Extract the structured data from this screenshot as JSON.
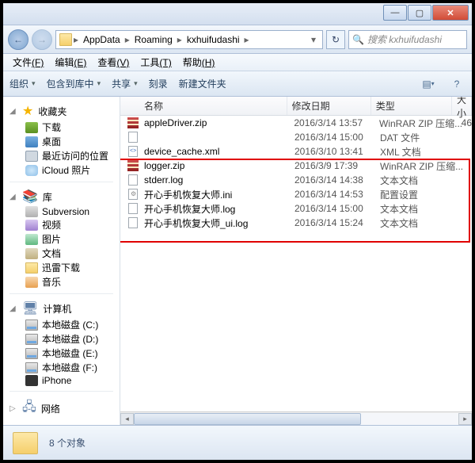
{
  "titlebar": {
    "min": "—",
    "max": "▢",
    "close": "✕"
  },
  "nav": {
    "back": "←",
    "forward": "→",
    "crumbs": [
      "AppData",
      "Roaming",
      "kxhuifudashi"
    ],
    "sep": "▸",
    "dropdown": "▾",
    "refresh": "↻"
  },
  "search": {
    "icon": "🔍",
    "placeholder": "搜索 kxhuifudashi"
  },
  "menu": {
    "file": {
      "label": "文件",
      "key": "(F)"
    },
    "edit": {
      "label": "编辑",
      "key": "(E)"
    },
    "view": {
      "label": "查看",
      "key": "(V)"
    },
    "tools": {
      "label": "工具",
      "key": "(T)"
    },
    "help": {
      "label": "帮助",
      "key": "(H)"
    }
  },
  "toolbar": {
    "organize": "组织",
    "include": "包含到库中",
    "share": "共享",
    "burn": "刻录",
    "newfolder": "新建文件夹",
    "arrow": "▾",
    "view_icon": "▤",
    "help_icon": "?"
  },
  "columns": {
    "name": "名称",
    "date": "修改日期",
    "type": "类型",
    "size": "大小"
  },
  "sidebar": {
    "fav": {
      "label": "收藏夹",
      "icon": "★"
    },
    "fav_items": [
      "下载",
      "桌面",
      "最近访问的位置",
      "iCloud 照片"
    ],
    "lib": {
      "label": "库",
      "icon": "📚"
    },
    "lib_items": [
      "Subversion",
      "视频",
      "图片",
      "文档",
      "迅雷下载",
      "音乐"
    ],
    "pc": {
      "label": "计算机",
      "icon": "🖥"
    },
    "pc_items": [
      "本地磁盘 (C:)",
      "本地磁盘 (D:)",
      "本地磁盘 (E:)",
      "本地磁盘 (F:)",
      "iPhone"
    ],
    "net": {
      "label": "网络",
      "icon": "🖧"
    },
    "expander_open": "◢",
    "expander_right": "▷"
  },
  "files": [
    {
      "icon": "zip",
      "name": "appleDriver.zip",
      "date": "2016/3/14 13:57",
      "type": "WinRAR ZIP 压缩...",
      "size": "46"
    },
    {
      "icon": "file",
      "name": "",
      "date": "2016/3/14 15:00",
      "type": "DAT 文件",
      "size": ""
    },
    {
      "icon": "xml",
      "name": "device_cache.xml",
      "date": "2016/3/10 13:41",
      "type": "XML 文档",
      "size": ""
    },
    {
      "icon": "zip",
      "name": "logger.zip",
      "date": "2016/3/9 17:39",
      "type": "WinRAR ZIP 压缩...",
      "size": ""
    },
    {
      "icon": "file",
      "name": "stderr.log",
      "date": "2016/3/14 14:38",
      "type": "文本文档",
      "size": ""
    },
    {
      "icon": "ini",
      "name": "开心手机恢复大师.ini",
      "date": "2016/3/14 14:53",
      "type": "配置设置",
      "size": ""
    },
    {
      "icon": "file",
      "name": "开心手机恢复大师.log",
      "date": "2016/3/14 15:00",
      "type": "文本文档",
      "size": ""
    },
    {
      "icon": "file",
      "name": "开心手机恢复大师_ui.log",
      "date": "2016/3/14 15:24",
      "type": "文本文档",
      "size": ""
    }
  ],
  "status": {
    "count": "8 个对象"
  }
}
